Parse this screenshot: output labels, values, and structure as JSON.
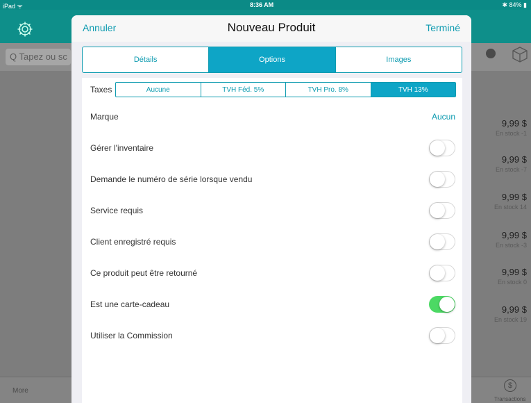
{
  "status_bar": {
    "carrier": "iPad ᯤ",
    "time": "8:36 AM",
    "battery": "✱ 84% ▮"
  },
  "background": {
    "search_placeholder": "Q Tapez ou sc",
    "prices": [
      {
        "amount": "9,99 $",
        "stock": "En stock -1"
      },
      {
        "amount": "9,99 $",
        "stock": "En stock -7"
      },
      {
        "amount": "9,99 $",
        "stock": "En stock 14"
      },
      {
        "amount": "9,99 $",
        "stock": "En stock -3"
      },
      {
        "amount": "9,99 $",
        "stock": "En stock 0"
      },
      {
        "amount": "9,99 $",
        "stock": "En stock 19"
      }
    ],
    "more_label": "More",
    "transactions_label": "Transactions",
    "dollar_symbol": "$"
  },
  "modal": {
    "cancel_label": "Annuler",
    "title": "Nouveau Produit",
    "done_label": "Terminé",
    "tabs": [
      {
        "label": "Détails",
        "active": false
      },
      {
        "label": "Options",
        "active": true
      },
      {
        "label": "Images",
        "active": false
      }
    ],
    "taxes": {
      "label": "Taxes",
      "options": [
        {
          "label": "Aucune",
          "active": false
        },
        {
          "label": "TVH Féd. 5%",
          "active": false
        },
        {
          "label": "TVH Pro. 8%",
          "active": false
        },
        {
          "label": "TVH 13%",
          "active": true
        }
      ]
    },
    "brand": {
      "label": "Marque",
      "value": "Aucun"
    },
    "options": [
      {
        "label": "Gérer l'inventaire",
        "on": false
      },
      {
        "label": "Demande le numéro de série lorsque vendu",
        "on": false
      },
      {
        "label": "Service requis",
        "on": false
      },
      {
        "label": "Client enregistré requis",
        "on": false
      },
      {
        "label": "Ce produit peut être retourné",
        "on": false
      },
      {
        "label": "Est une carte-cadeau",
        "on": true
      },
      {
        "label": "Utiliser la Commission",
        "on": false
      }
    ]
  },
  "colors": {
    "accent": "#0ea5c6",
    "toggle_on": "#4cd964",
    "header_bg": "#0e8f8a"
  }
}
